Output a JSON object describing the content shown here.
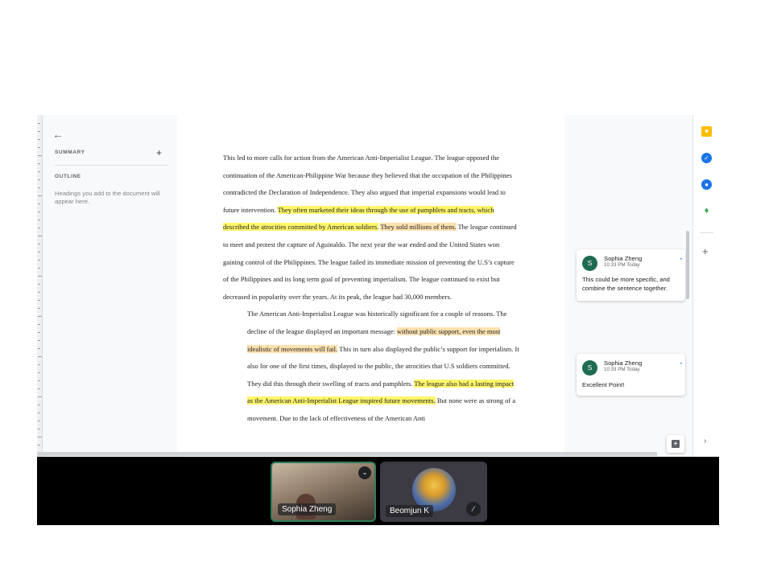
{
  "outline_panel": {
    "back_icon": "arrow-left-icon",
    "summary_label": "SUMMARY",
    "summary_add": "+",
    "outline_label": "OUTLINE",
    "outline_help": "Headings you add to the document will appear here."
  },
  "document": {
    "paragraphs": [
      [
        {
          "text": "This led to more calls for action from the American Anti-Imperialist League. The league opposed the continuation of the American-Philippine War because they believed that the occupation of the Philippines contradicted the Declaration of Independence. They also argued that imperial expansions would lead to future intervention. ",
          "hl": ""
        },
        {
          "text": "They often marketed their ideas through the use of pamphlets and tracts, which described the atrocities committed by American soldiers.",
          "hl": "yellow"
        },
        {
          "text": " ",
          "hl": ""
        },
        {
          "text": "They sold millions of them.",
          "hl": "peach"
        },
        {
          "text": " The league continued to meet and protest the capture of Aguinaldo. The next year the war ended and the United States won gaining control of the Philippines. The league failed its immediate mission of preventing the U.S’s capture of the Philippines and its long term goal of preventing imperialism. The league continued to exist but decreased in popularity over the years. At its peak, the league had 30,000 members.",
          "hl": ""
        }
      ],
      [
        {
          "text": "The American Anti-Imperialist League was historically significant for a couple of reasons. The decline of the league displayed an important message: ",
          "hl": ""
        },
        {
          "text": "without public support, even the most idealistic of movements will fail.",
          "hl": "peach"
        },
        {
          "text": " This in turn also displayed the public’s support for imperialism. It also for one of the first times, displayed to the public, the atrocities that U.S soldiers committed. They did this through their swelling of tracts and pamphlets. ",
          "hl": ""
        },
        {
          "text": "The league also had a lasting impact as the American Anti-Imperialist League inspired future movements.",
          "hl": "yellow"
        },
        {
          "text": " But none were as strong of a movement. Due to the lack of effectiveness of the American Anti",
          "hl": ""
        }
      ]
    ]
  },
  "comments": [
    {
      "avatar_letter": "S",
      "author": "Sophia Zheng",
      "time": "10:33 PM Today",
      "body": "This could be more specific, and combine the sentence together."
    },
    {
      "avatar_letter": "S",
      "author": "Sophia Zheng",
      "time": "10:33 PM Today",
      "body": "Excellent Point!"
    }
  ],
  "side_apps": {
    "icons": [
      "keep-icon",
      "tasks-icon",
      "contacts-icon",
      "maps-icon"
    ],
    "add": "+",
    "expand": "›"
  },
  "meet": {
    "participants": [
      {
        "name": "Sophia Zheng",
        "active_speaker": true
      },
      {
        "name": "Beomjun K",
        "muted": true
      }
    ]
  },
  "colors": {
    "highlight_yellow": "#fef66a",
    "highlight_peach": "#fde1ae",
    "avatar": "#1e6b52",
    "accent": "#1a73e8"
  }
}
